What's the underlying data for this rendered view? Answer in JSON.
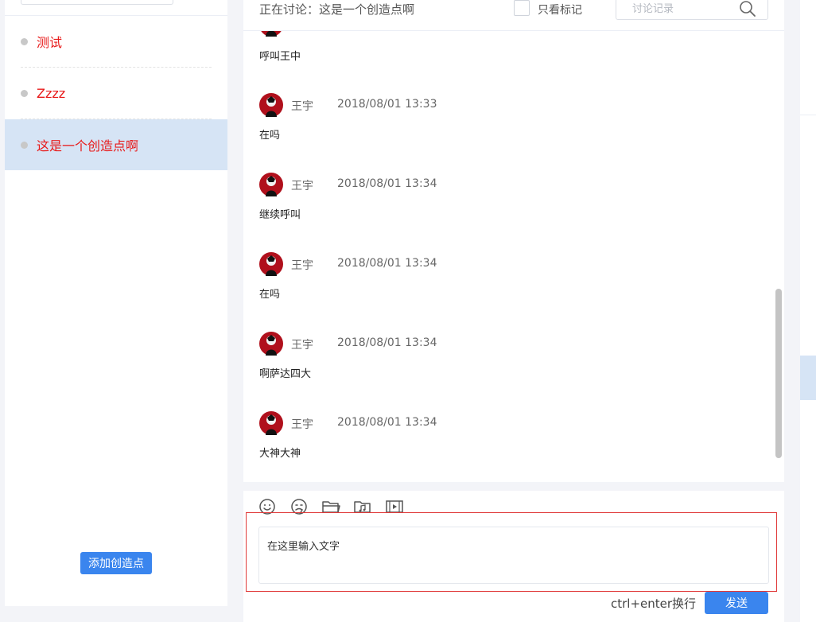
{
  "left_panel": {
    "items": [
      {
        "label": "测试",
        "active": false
      },
      {
        "label": "Zzzz",
        "active": false
      },
      {
        "label": "这是一个创造点啊",
        "active": true
      }
    ],
    "add_button": "添加创造点"
  },
  "header": {
    "discussing": "正在讨论：这是一个创造点啊",
    "only_marked": "只看标记",
    "search_placeholder": "讨论记录"
  },
  "messages": {
    "first_partial_text": "呼叫王中",
    "items": [
      {
        "name": "王宇",
        "time": "2018/08/01 13:33",
        "text": "在吗"
      },
      {
        "name": "王宇",
        "time": "2018/08/01 13:34",
        "text": "继续呼叫"
      },
      {
        "name": "王宇",
        "time": "2018/08/01 13:34",
        "text": "在吗"
      },
      {
        "name": "王宇",
        "time": "2018/08/01 13:34",
        "text": "啊萨达四大"
      },
      {
        "name": "王宇",
        "time": "2018/08/01 13:34",
        "text": "大神大神"
      }
    ]
  },
  "compose": {
    "placeholder": "在这里输入文字",
    "hint": "ctrl+enter换行",
    "send": "发送",
    "tools": [
      "emoji-icon",
      "sticker-icon",
      "folder-icon",
      "music-folder-icon",
      "video-icon"
    ]
  },
  "colors": {
    "accent": "#3a85ee",
    "highlight": "#d6e4f5",
    "item_text": "#e81a1a",
    "outline": "#e03a3a"
  }
}
